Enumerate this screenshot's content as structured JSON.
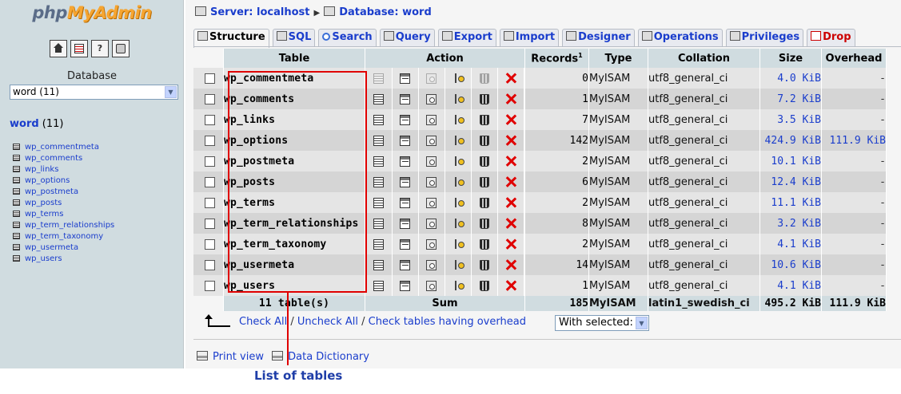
{
  "app": {
    "logo_part1": "php",
    "logo_part2": "MyAdmin"
  },
  "left": {
    "icons": [
      "home-icon",
      "sql-query-icon",
      "help-icon",
      "docs-icon"
    ],
    "database_label": "Database",
    "database_select_value": "word (11)",
    "db_heading_name": "word",
    "db_heading_count": " (11)",
    "tables": [
      "wp_commentmeta",
      "wp_comments",
      "wp_links",
      "wp_options",
      "wp_postmeta",
      "wp_posts",
      "wp_terms",
      "wp_term_relationships",
      "wp_term_taxonomy",
      "wp_usermeta",
      "wp_users"
    ]
  },
  "breadcrumb": {
    "server": "Server: localhost",
    "database": "Database: word"
  },
  "tabs": [
    {
      "label": "Structure",
      "active": true
    },
    {
      "label": "SQL"
    },
    {
      "label": "Search"
    },
    {
      "label": "Query"
    },
    {
      "label": "Export"
    },
    {
      "label": "Import"
    },
    {
      "label": "Designer"
    },
    {
      "label": "Operations"
    },
    {
      "label": "Privileges"
    },
    {
      "label": "Drop"
    }
  ],
  "table_headers": {
    "table": "Table",
    "action": "Action",
    "records": "Records",
    "records_sup": "1",
    "type": "Type",
    "collation": "Collation",
    "size": "Size",
    "overhead": "Overhead"
  },
  "rows": [
    {
      "name": "wp_commentmeta",
      "records": "0",
      "type": "MyISAM",
      "collation": "utf8_general_ci",
      "size": "4.0 KiB",
      "overhead": "-",
      "empty": true
    },
    {
      "name": "wp_comments",
      "records": "1",
      "type": "MyISAM",
      "collation": "utf8_general_ci",
      "size": "7.2 KiB",
      "overhead": "-"
    },
    {
      "name": "wp_links",
      "records": "7",
      "type": "MyISAM",
      "collation": "utf8_general_ci",
      "size": "3.5 KiB",
      "overhead": "-"
    },
    {
      "name": "wp_options",
      "records": "142",
      "type": "MyISAM",
      "collation": "utf8_general_ci",
      "size": "424.9 KiB",
      "overhead": "111.9 KiB"
    },
    {
      "name": "wp_postmeta",
      "records": "2",
      "type": "MyISAM",
      "collation": "utf8_general_ci",
      "size": "10.1 KiB",
      "overhead": "-"
    },
    {
      "name": "wp_posts",
      "records": "6",
      "type": "MyISAM",
      "collation": "utf8_general_ci",
      "size": "12.4 KiB",
      "overhead": "-"
    },
    {
      "name": "wp_terms",
      "records": "2",
      "type": "MyISAM",
      "collation": "utf8_general_ci",
      "size": "11.1 KiB",
      "overhead": "-"
    },
    {
      "name": "wp_term_relationships",
      "records": "8",
      "type": "MyISAM",
      "collation": "utf8_general_ci",
      "size": "3.2 KiB",
      "overhead": "-"
    },
    {
      "name": "wp_term_taxonomy",
      "records": "2",
      "type": "MyISAM",
      "collation": "utf8_general_ci",
      "size": "4.1 KiB",
      "overhead": "-"
    },
    {
      "name": "wp_usermeta",
      "records": "14",
      "type": "MyISAM",
      "collation": "utf8_general_ci",
      "size": "10.6 KiB",
      "overhead": "-"
    },
    {
      "name": "wp_users",
      "records": "1",
      "type": "MyISAM",
      "collation": "utf8_general_ci",
      "size": "4.1 KiB",
      "overhead": "-"
    }
  ],
  "summary": {
    "tables": "11 table(s)",
    "label": "Sum",
    "records": "185",
    "type": "MyISAM",
    "collation": "latin1_swedish_ci",
    "size": "495.2 KiB",
    "overhead": "111.9 KiB"
  },
  "footer": {
    "check_all": "Check All",
    "uncheck_all": "Uncheck All",
    "check_overhead": "Check tables having overhead",
    "with_selected": "With selected:",
    "print_view": "Print view",
    "data_dictionary": "Data Dictionary"
  },
  "annotation": {
    "label": "List of tables",
    "color": "#e00000"
  },
  "colors": {
    "link": "#1a3dcc",
    "header_bg": "#d0dce0",
    "row_odd": "#e5e5e5",
    "row_even": "#d5d5d5",
    "drop_red": "#e00000"
  }
}
